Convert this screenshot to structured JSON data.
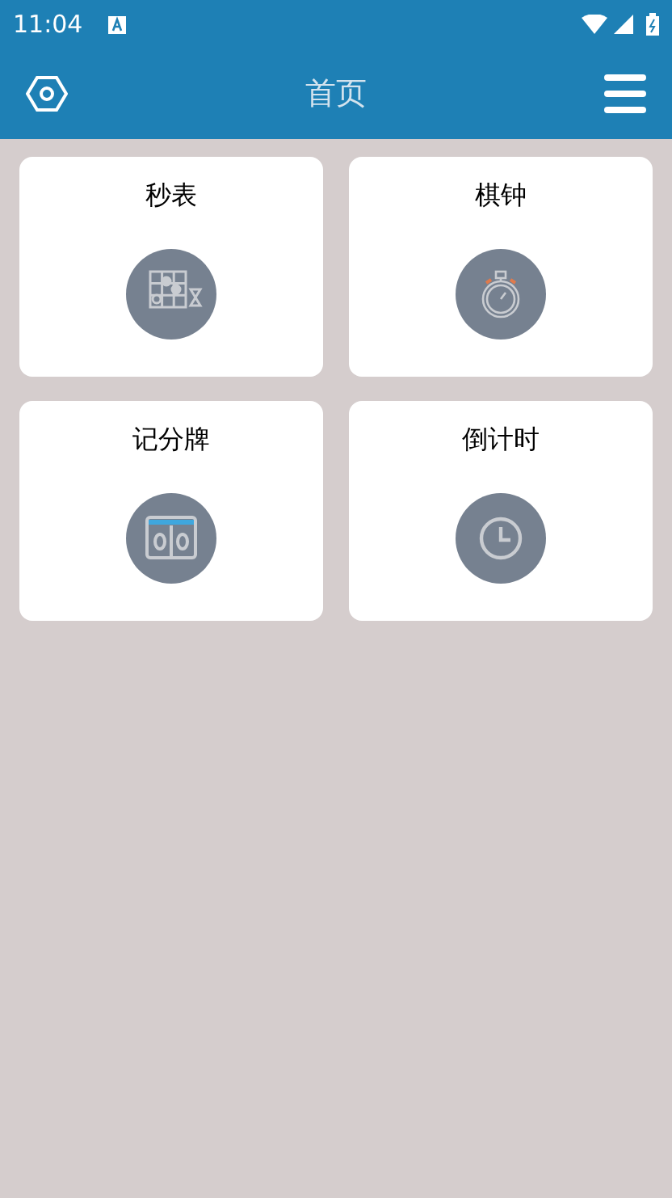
{
  "status_bar": {
    "time": "11:04"
  },
  "app_bar": {
    "title": "首页"
  },
  "tools": [
    {
      "label": "秒表",
      "kind": "board"
    },
    {
      "label": "棋钟",
      "kind": "stopwatch"
    },
    {
      "label": "记分牌",
      "kind": "scoreboard"
    },
    {
      "label": "倒计时",
      "kind": "clock"
    }
  ]
}
